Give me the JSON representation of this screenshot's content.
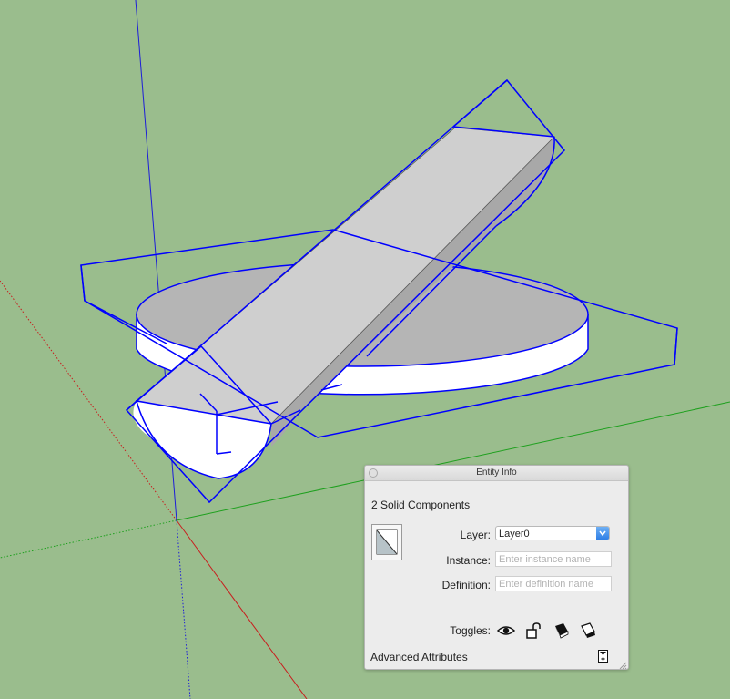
{
  "panel": {
    "title": "Entity Info",
    "selection_summary": "2 Solid Components",
    "layer_label": "Layer:",
    "layer_value": "Layer0",
    "instance_label": "Instance:",
    "instance_placeholder": "Enter instance name",
    "instance_value": "",
    "definition_label": "Definition:",
    "definition_placeholder": "Enter definition name",
    "definition_value": "",
    "toggles_label": "Toggles:",
    "toggles": [
      {
        "name": "visibility-toggle",
        "icon": "eye-icon"
      },
      {
        "name": "lock-toggle",
        "icon": "unlock-icon"
      },
      {
        "name": "receive-shadows-toggle",
        "icon": "receive-shadows-icon"
      },
      {
        "name": "cast-shadows-toggle",
        "icon": "cast-shadows-icon"
      }
    ],
    "advanced_label": "Advanced Attributes"
  },
  "colors": {
    "background": "#9abd8d",
    "selection": "#0000ff",
    "axis_red": "#c81e1e",
    "axis_green": "#1ea01e",
    "axis_blue": "#1d1dd8"
  }
}
